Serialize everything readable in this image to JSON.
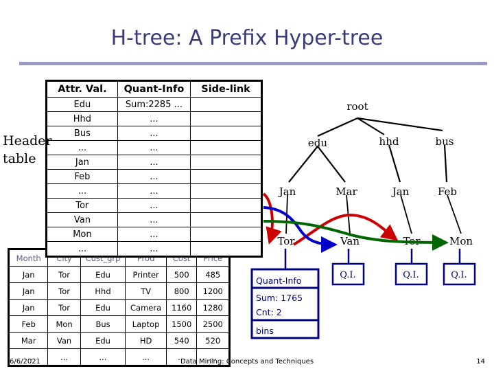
{
  "slide": {
    "title": "H-tree: A Prefix Hyper-tree",
    "header_table_label_line1": "Header",
    "header_table_label_line2": "table"
  },
  "header_table": {
    "columns": [
      "Attr. Val.",
      "Quant-Info",
      "Side-link"
    ],
    "rows": [
      {
        "attr": "Edu",
        "quant": "Sum:2285 ...",
        "side": "",
        "color": "black"
      },
      {
        "attr": "Hhd",
        "quant": "...",
        "side": "",
        "color": "black"
      },
      {
        "attr": "Bus",
        "quant": "...",
        "side": "",
        "color": "black"
      },
      {
        "attr": "...",
        "quant": "...",
        "side": "",
        "color": "black"
      },
      {
        "attr": "Jan",
        "quant": "...",
        "side": "",
        "color": "black"
      },
      {
        "attr": "Feb",
        "quant": "...",
        "side": "",
        "color": "black"
      },
      {
        "attr": "...",
        "quant": "...",
        "side": "",
        "color": "black"
      },
      {
        "attr": "Tor",
        "quant": "...",
        "side": "",
        "color": "red"
      },
      {
        "attr": "Van",
        "quant": "...",
        "side": "",
        "color": "blue"
      },
      {
        "attr": "Mon",
        "quant": "...",
        "side": "",
        "color": "green"
      },
      {
        "attr": "...",
        "quant": "...",
        "side": "",
        "color": "black"
      }
    ]
  },
  "data_table": {
    "columns": [
      "Month",
      "City",
      "Cust_grp",
      "Prod",
      "Cost",
      "Price"
    ],
    "rows": [
      [
        "Jan",
        "Tor",
        "Edu",
        "Printer",
        "500",
        "485"
      ],
      [
        "Jan",
        "Tor",
        "Hhd",
        "TV",
        "800",
        "1200"
      ],
      [
        "Jan",
        "Tor",
        "Edu",
        "Camera",
        "1160",
        "1280"
      ],
      [
        "Feb",
        "Mon",
        "Bus",
        "Laptop",
        "1500",
        "2500"
      ],
      [
        "Mar",
        "Van",
        "Edu",
        "HD",
        "540",
        "520"
      ],
      [
        "...",
        "...",
        "...",
        "...",
        "...",
        "..."
      ]
    ]
  },
  "tree": {
    "root_label": "root",
    "level1": [
      "edu",
      "hhd",
      "bus"
    ],
    "level2": [
      "Jan",
      "Mar",
      "Jan",
      "Feb"
    ],
    "level3": [
      "Tor",
      "Van",
      "Tor",
      "Mon"
    ],
    "quant_box": {
      "title": "Quant-Info",
      "sum": "Sum: 1765",
      "cnt": "Cnt: 2",
      "bins": "bins"
    },
    "qi_boxes": [
      "Q.I.",
      "Q.I.",
      "Q.I."
    ],
    "sidelink_colors": {
      "tor": "#cc0000",
      "van": "#0000cc",
      "mon": "#006600"
    }
  },
  "footer": {
    "date": "6/6/2021",
    "center": "Data Mining: Concepts and Techniques",
    "page": "14"
  }
}
